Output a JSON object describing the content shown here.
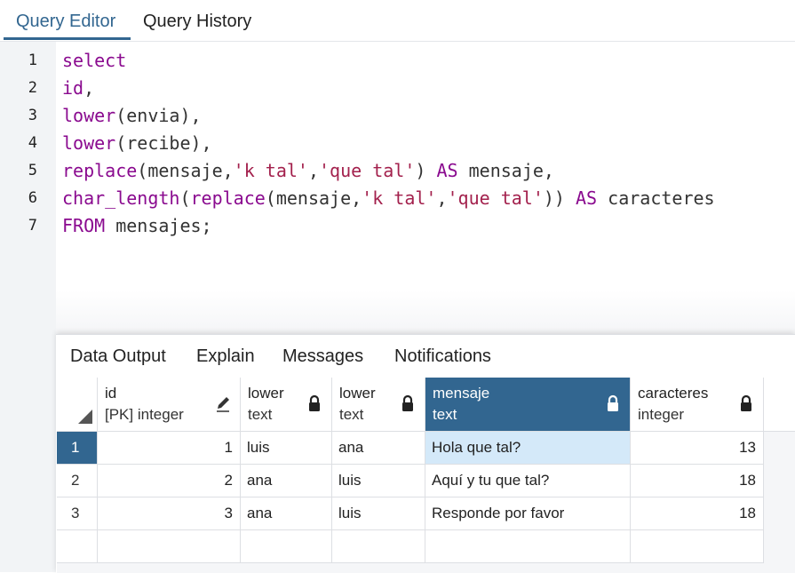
{
  "tabs": {
    "query_editor": "Query Editor",
    "query_history": "Query History"
  },
  "editor": {
    "line_numbers": [
      "1",
      "2",
      "3",
      "4",
      "5",
      "6",
      "7"
    ]
  },
  "results": {
    "tabs": {
      "data_output": "Data Output",
      "explain": "Explain",
      "messages": "Messages",
      "notifications": "Notifications"
    },
    "columns": [
      {
        "name": "id",
        "type": "[PK] integer",
        "icon": "pencil-icon"
      },
      {
        "name": "lower",
        "type": "text",
        "icon": "lock-icon"
      },
      {
        "name": "lower",
        "type": "text",
        "icon": "lock-icon"
      },
      {
        "name": "mensaje",
        "type": "text",
        "icon": "lock-icon"
      },
      {
        "name": "caracteres",
        "type": "integer",
        "icon": "lock-icon"
      }
    ],
    "rows": [
      {
        "rownum": "1",
        "id": "1",
        "envia": "luis",
        "recibe": "ana",
        "mensaje": "Hola que tal?",
        "caracteres": "13"
      },
      {
        "rownum": "2",
        "id": "2",
        "envia": "ana",
        "recibe": "luis",
        "mensaje": "Aquí y tu que tal?",
        "caracteres": "18"
      },
      {
        "rownum": "3",
        "id": "3",
        "envia": "ana",
        "recibe": "luis",
        "mensaje": "Responde por favor",
        "caracteres": "18"
      }
    ]
  },
  "colors": {
    "accent": "#326690",
    "keyword": "#8a0a8f",
    "string": "#a3214d",
    "selected_cell": "#d4e9f9"
  }
}
